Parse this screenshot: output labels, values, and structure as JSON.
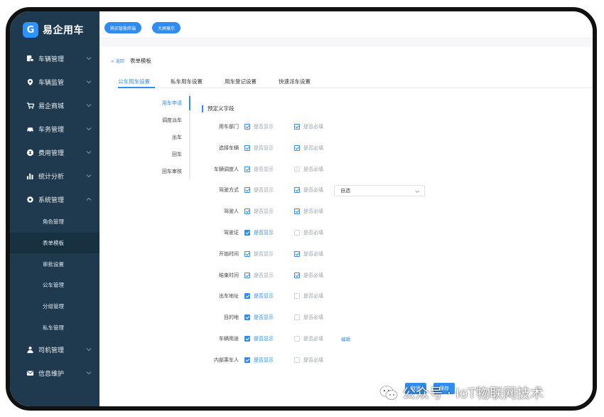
{
  "app": {
    "logo_text": "易企用车",
    "logo_mark": "G"
  },
  "sidebar": {
    "items": [
      {
        "label": "车辆管理",
        "icon": "car-doc-icon"
      },
      {
        "label": "车辆监管",
        "icon": "location-pin-icon"
      },
      {
        "label": "易企商城",
        "icon": "cart-icon"
      },
      {
        "label": "车务管理",
        "icon": "car-icon"
      },
      {
        "label": "费用管理",
        "icon": "coin-icon"
      },
      {
        "label": "统计分析",
        "icon": "bar-chart-icon"
      },
      {
        "label": "系统管理",
        "icon": "gear-icon"
      }
    ],
    "submenu": [
      "角色管理",
      "表单模板",
      "审批设置",
      "公车管理",
      "分组管理",
      "私车管理"
    ],
    "active_submenu": "表单模板",
    "bottom_items": [
      {
        "label": "司机管理",
        "icon": "person-icon"
      },
      {
        "label": "信息维护",
        "icon": "mail-icon"
      }
    ]
  },
  "topbar": {
    "pill1": "购买智能终端",
    "pill2": "大屏展示"
  },
  "breadcrumb": {
    "back": "< 返回",
    "title": "表单模板"
  },
  "tabs": [
    "公车用车设置",
    "私车用车设置",
    "用车登记设置",
    "快速派车设置"
  ],
  "active_tab": "公车用车设置",
  "subnav": [
    "用车申请",
    "调度派车",
    "出车",
    "回车",
    "回车审核"
  ],
  "active_subnav": "用车申请",
  "section_title": "预定义字段",
  "option_show": "是否显示",
  "option_required": "是否必填",
  "fields": [
    {
      "label": "用车部门",
      "show": "checked",
      "required": "checked"
    },
    {
      "label": "选择车辆",
      "show": "checked",
      "required": "checked"
    },
    {
      "label": "车辆调度人",
      "show": "checked",
      "required": "disabled"
    },
    {
      "label": "驾驶方式",
      "show": "checked",
      "required": "checked",
      "select": "自选"
    },
    {
      "label": "驾驶人",
      "show": "checked",
      "required": "checked"
    },
    {
      "label": "驾驶证",
      "show": "filled",
      "required": "empty"
    },
    {
      "label": "开始时间",
      "show": "checked",
      "required": "checked"
    },
    {
      "label": "结束时间",
      "show": "checked",
      "required": "checked"
    },
    {
      "label": "出车地址",
      "show": "filled",
      "required": "empty"
    },
    {
      "label": "目的地",
      "show": "filled",
      "required": "empty"
    },
    {
      "label": "车辆用途",
      "show": "filled",
      "required": "empty",
      "edit": "编辑"
    },
    {
      "label": "内部乘车人",
      "show": "filled",
      "required": "empty"
    }
  ],
  "buttons": {
    "cancel": "取消",
    "save": "保存"
  },
  "watermark": "公众号 · IoT物联网技术",
  "colors": {
    "sidebar": "#1f3a4f",
    "accent": "#2f8cf0"
  }
}
